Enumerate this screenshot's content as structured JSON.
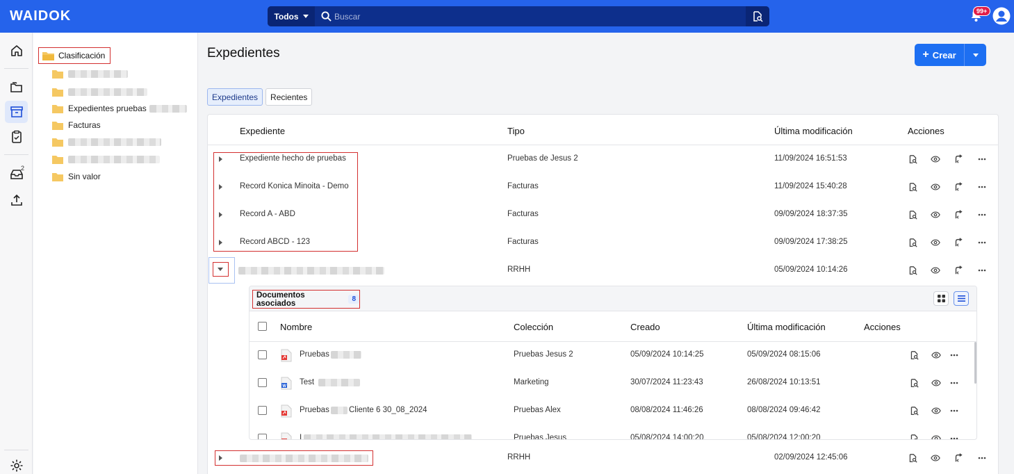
{
  "app": {
    "logo": "WAIDOK"
  },
  "search": {
    "scope": "Todos",
    "placeholder": "Buscar"
  },
  "notifications": {
    "badge": "99+"
  },
  "rail": {
    "inbox_count": "2"
  },
  "tree": {
    "root_label": "Clasificación",
    "items": [
      {
        "label": "",
        "blurred": true
      },
      {
        "label": "",
        "blurred": true
      },
      {
        "label": "Expedientes pruebas",
        "blurred_suffix": true
      },
      {
        "label": "Facturas"
      },
      {
        "label": "",
        "blurred": true
      },
      {
        "label": "",
        "blurred": true
      },
      {
        "label": "Sin valor"
      }
    ]
  },
  "main": {
    "title": "Expedientes",
    "create_label": "Crear",
    "tabs": [
      "Expedientes",
      "Recientes"
    ]
  },
  "table": {
    "headers": {
      "expediente": "Expediente",
      "tipo": "Tipo",
      "modificacion": "Última modificación",
      "acciones": "Acciones"
    },
    "rows": [
      {
        "expediente": "Expediente hecho de pruebas",
        "tipo": "Pruebas de Jesus 2",
        "modificacion": "11/09/2024 16:51:53"
      },
      {
        "expediente": "Record Konica Minoita - Demo",
        "tipo": "Facturas",
        "modificacion": "11/09/2024 15:40:28"
      },
      {
        "expediente": "Record A - ABD",
        "tipo": "Facturas",
        "modificacion": "09/09/2024 18:37:35"
      },
      {
        "expediente": "Record ABCD - 123",
        "tipo": "Facturas",
        "modificacion": "09/09/2024 17:38:25"
      },
      {
        "expediente": "",
        "tipo": "RRHH",
        "modificacion": "05/09/2024 10:14:26",
        "expanded": true
      },
      {
        "expediente": "",
        "tipo": "RRHH",
        "modificacion": "02/09/2024 12:45:06"
      }
    ]
  },
  "documents": {
    "title": "Documentos asociados",
    "count": "8",
    "headers": {
      "nombre": "Nombre",
      "coleccion": "Colección",
      "creado": "Creado",
      "modificacion": "Última modificación",
      "acciones": "Acciones"
    },
    "rows": [
      {
        "nombre": "Pruebas",
        "type": "pdf",
        "coleccion": "Pruebas Jesus 2",
        "creado": "05/09/2024 10:14:25",
        "modificacion": "05/09/2024 08:15:06"
      },
      {
        "nombre": "Test",
        "type": "word",
        "coleccion": "Marketing",
        "creado": "30/07/2024 11:23:43",
        "modificacion": "26/08/2024 10:13:51"
      },
      {
        "nombre": "Pruebas",
        "nombre_suffix": "Cliente 6 30_08_2024",
        "type": "pdf",
        "coleccion": "Pruebas Alex",
        "creado": "08/08/2024 11:46:26",
        "modificacion": "08/08/2024 09:46:42"
      },
      {
        "nombre": "I",
        "type": "pdf",
        "coleccion": "Pruebas Jesus",
        "creado": "05/08/2024 14:00:20",
        "modificacion": "05/08/2024 12:00:20"
      }
    ]
  },
  "colors": {
    "primary": "#2563eb",
    "highlight": "#d32f2f",
    "folder": "#f5c862"
  }
}
